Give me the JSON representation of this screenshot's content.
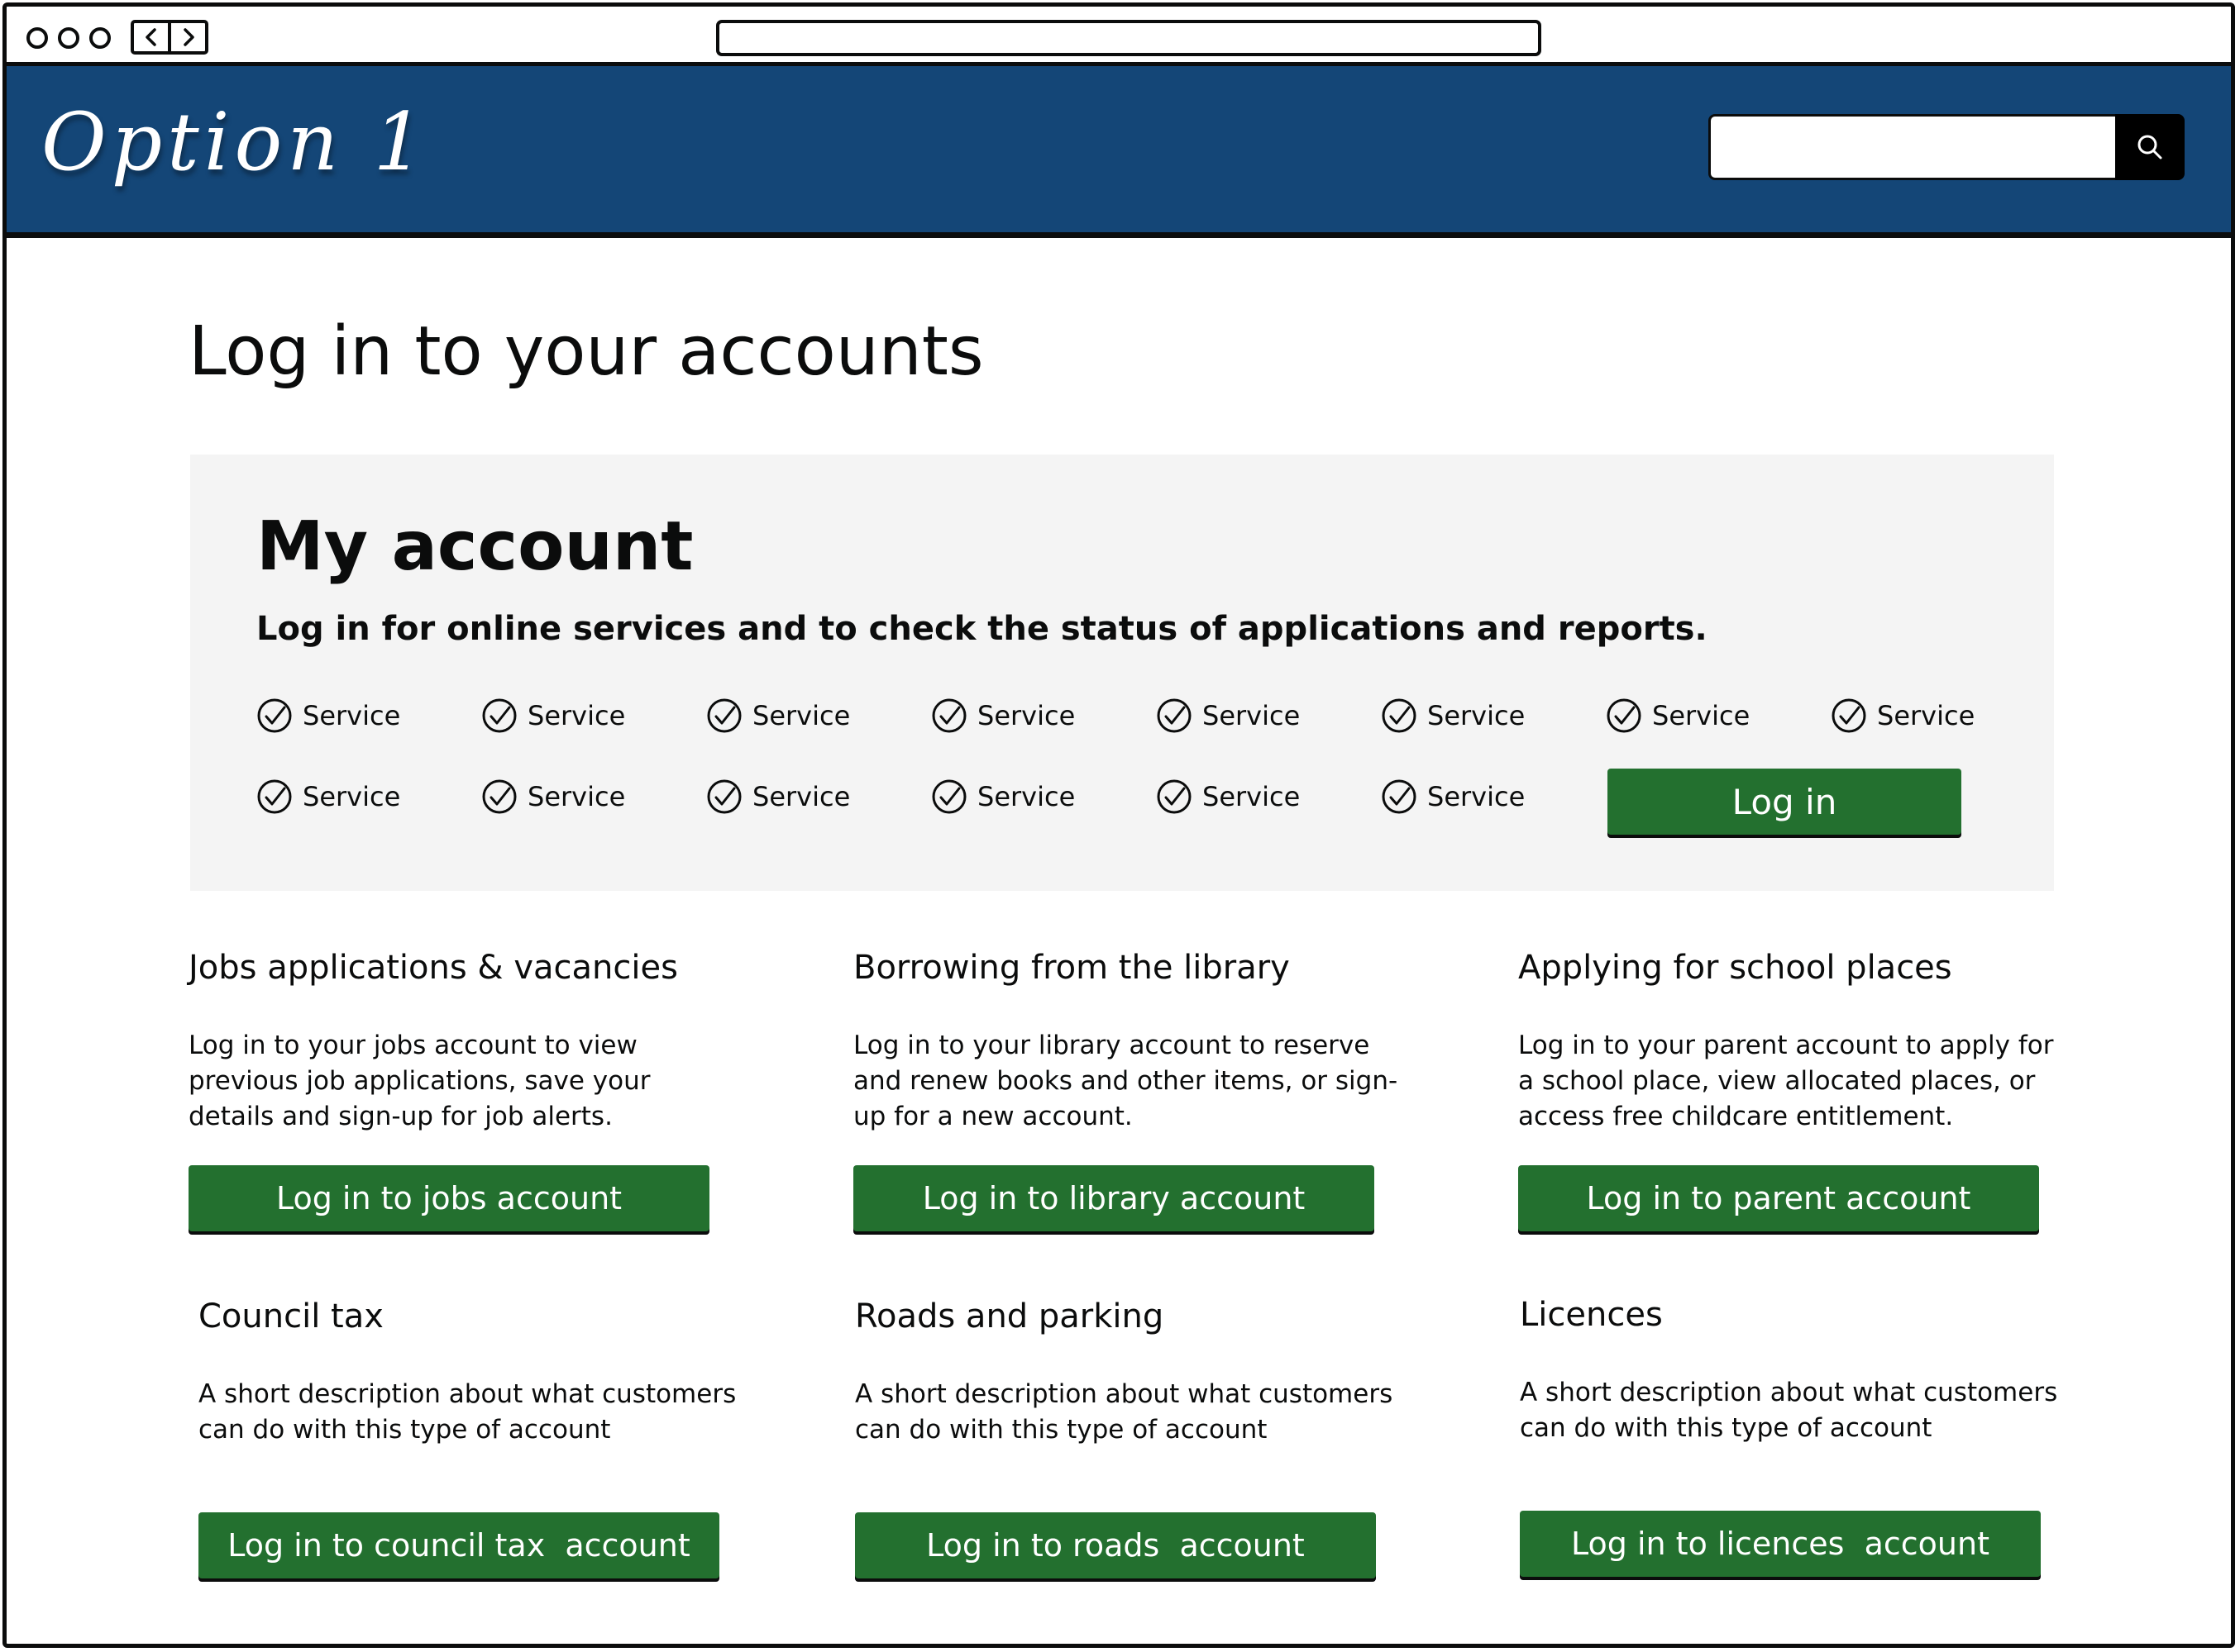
{
  "header": {
    "option_title": "Option 1",
    "search": {
      "placeholder": ""
    }
  },
  "page": {
    "title": "Log in to your accounts"
  },
  "my_account": {
    "heading": "My account",
    "description": "Log in for online services and to check the status of applications and reports.",
    "services": [
      "Service",
      "Service",
      "Service",
      "Service",
      "Service",
      "Service",
      "Service",
      "Service",
      "Service",
      "Service",
      "Service",
      "Service",
      "Service",
      "Service"
    ],
    "login_label": "Log in"
  },
  "cards": [
    {
      "title": "Jobs applications & vacancies",
      "description": "Log in to your jobs account to view previous job applications, save your details and sign-up for job alerts.",
      "button": "Log in to jobs account"
    },
    {
      "title": "Borrowing from the library",
      "description": "Log in to your library account to reserve and renew books and other items, or sign-up for a new account.",
      "button": "Log in to library account"
    },
    {
      "title": "Applying for school places",
      "description": "Log in to your parent account to apply for a school place, view allocated places, or access free childcare entitlement.",
      "button": "Log in to parent account"
    },
    {
      "title": "Council tax",
      "description": "A short description about what customers can do with this type of account",
      "button": "Log in to council tax  account"
    },
    {
      "title": "Roads and parking",
      "description": "A short description about what customers can do with this type of account",
      "button": "Log in to roads  account"
    },
    {
      "title": "Licences",
      "description": "A short description about what customers can do with this type of account",
      "button": "Log in to licences  account"
    }
  ],
  "colors": {
    "header_blue": "#144677",
    "button_green": "#23702f",
    "panel_grey": "#f4f4f4"
  },
  "icons": {
    "service": "check-circle-icon",
    "search": "search-icon",
    "back": "chevron-left-icon",
    "forward": "chevron-right-icon"
  }
}
